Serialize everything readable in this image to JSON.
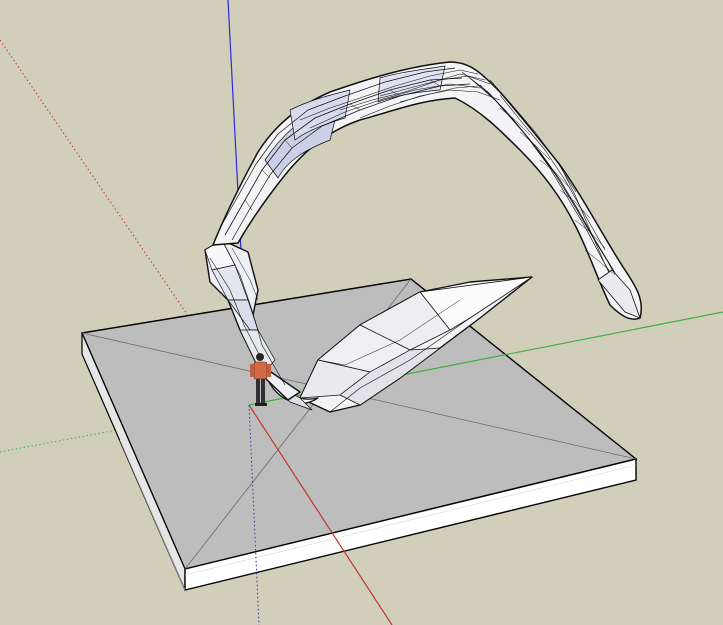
{
  "viewport": {
    "background_color": "#d1cfb9"
  },
  "scene": {
    "axes": {
      "red_color": "#c4362f",
      "green_color": "#3fae3f",
      "blue_color": "#2a2adf"
    },
    "slab": {
      "top_color": "#bdbdbd",
      "side_color": "#ffffff",
      "edge_color": "#000000"
    },
    "sculpture": {
      "face_color": "#f4f4f6",
      "shade_color": "#c9d0e8",
      "edge_color": "#111111"
    },
    "figure": {
      "shirt_color": "#d46a45",
      "pants_color": "#2f2f35"
    }
  }
}
